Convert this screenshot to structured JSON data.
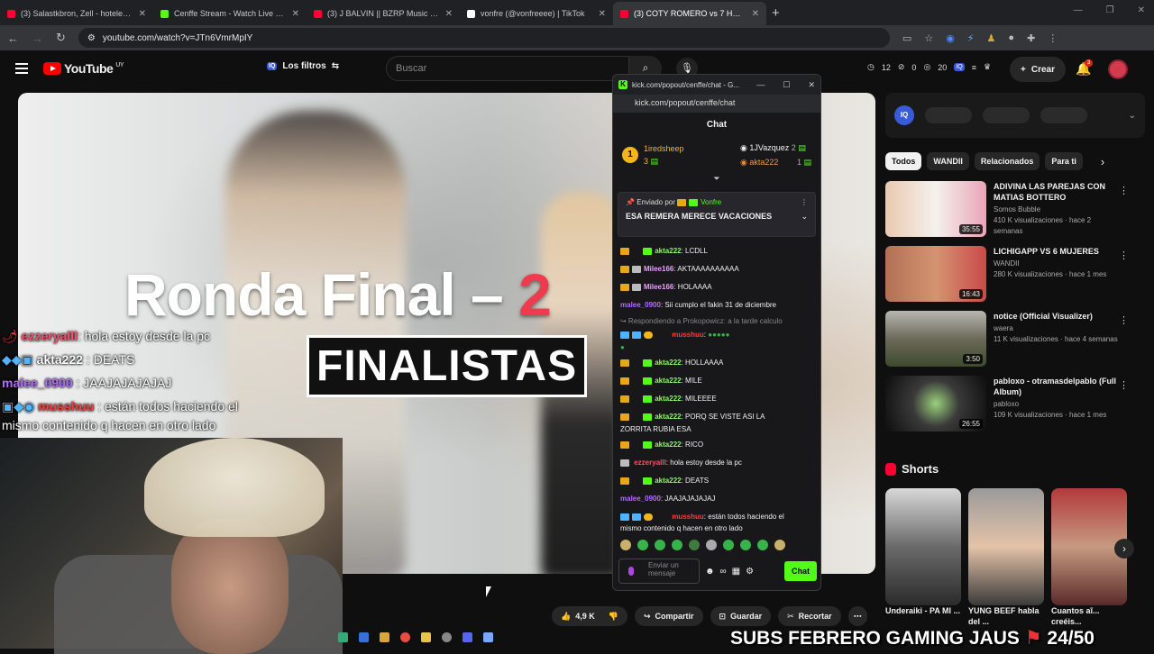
{
  "tabs": [
    {
      "title": "(3) Salastkbron, Zell - hoteles (p",
      "color": "#ff0033"
    },
    {
      "title": "Cenffe Stream - Watch Live on K",
      "color": "#53fc18"
    },
    {
      "title": "(3) J BALVIN || BZRP Music Sess",
      "color": "#ff0033"
    },
    {
      "title": "vonfre (@vonfreeee) | TikTok",
      "color": "#ffffff"
    },
    {
      "title": "(3) COTY ROMERO vs 7 HOMBR",
      "color": "#ff0033"
    }
  ],
  "browser": {
    "url": "youtube.com/watch?v=JTn6VmrMpIY",
    "new_tab": "+"
  },
  "youtube": {
    "logo": "YouTube",
    "country": "UY",
    "filters": "Los filtros",
    "iq": "IQ",
    "search_placeholder": "Buscar",
    "stats": {
      "a": "12",
      "b": "0",
      "c": "20"
    },
    "create": "Crear",
    "notif_count": "3"
  },
  "video": {
    "title_line": "Ronda Final –",
    "title_num": "2",
    "subtitle": "FINALISTAS"
  },
  "overlay_chat": [
    {
      "user": "ezzeryalll",
      "text": ": hola estoy desde la pc",
      "color": "#ff4d6d"
    },
    {
      "user": "akta222",
      "text": " : DEATS",
      "color": "#ffffff"
    },
    {
      "user": "malee_0900",
      "text": " : JAAJAJAJAJAJ",
      "color": "#b36bff"
    },
    {
      "user": "musshuu",
      "text": " : están todos haciendo el",
      "color": "#ff3b3b"
    },
    {
      "user": "",
      "text": "mismo contenido q hacen en otro lado",
      "color": "#ffffff"
    }
  ],
  "popout": {
    "title": "kick.com/popout/cenffe/chat - G...",
    "url": "kick.com/popout/cenffe/chat",
    "header": "Chat",
    "leaders": {
      "first": {
        "rank": "1",
        "name": "1iredsheep",
        "count": "3"
      },
      "second": {
        "name": "1JVazquez",
        "count": "2"
      },
      "third": {
        "name": "akta222",
        "count": "1"
      }
    },
    "pinned": {
      "by": "Enviado por",
      "user": "Vonfre",
      "message": "ESA REMERA MERECE VACACIONES"
    },
    "messages": [
      {
        "user": "akta222",
        "text": ": LCDLL",
        "color": "#53fc18"
      },
      {
        "user": "Milee166",
        "text": ": AKTAAAAAAAAAA",
        "color": "#e8a0ff"
      },
      {
        "user": "Milee166",
        "text": ": HOLAAAA",
        "color": "#e8a0ff"
      },
      {
        "user": "malee_0900",
        "text": ": Sii cumplo el fakin 31 de diciembre",
        "color": "#b36bff"
      },
      {
        "user": "",
        "text": "↪ Respondiendo a Prokopowicz: a la tarde calculo",
        "color": "#888888"
      },
      {
        "user": "musshuu",
        "text": ":",
        "color": "#ff3b3b"
      },
      {
        "user": "akta222",
        "text": ": HOLLAAAA",
        "color": "#53fc18"
      },
      {
        "user": "akta222",
        "text": ": MILE",
        "color": "#53fc18"
      },
      {
        "user": "akta222",
        "text": ": MILEEEE",
        "color": "#53fc18"
      },
      {
        "user": "akta222",
        "text": ": PORQ SE VISTE ASI LA",
        "color": "#53fc18"
      },
      {
        "user": "",
        "text": "ZORRITA RUBIA ESA",
        "color": "#ffffff"
      },
      {
        "user": "akta222",
        "text": ": RICO",
        "color": "#53fc18"
      },
      {
        "user": "ezzeryalll",
        "text": ": hola estoy desde la pc",
        "color": "#ff4d6d"
      },
      {
        "user": "akta222",
        "text": ": DEATS",
        "color": "#53fc18"
      },
      {
        "user": "malee_0900",
        "text": ": JAAJAJAJAJAJ",
        "color": "#b36bff"
      },
      {
        "user": "musshuu",
        "text": ": están todos haciendo el",
        "color": "#ff3b3b"
      },
      {
        "user": "",
        "text": "mismo contenido q hacen en otro lado",
        "color": "#ffffff"
      }
    ],
    "input_placeholder": "Enviar un mensaje",
    "send": "Chat"
  },
  "sidebar": {
    "iq": "IQ",
    "chips": [
      "Todos",
      "WANDII",
      "Relacionados",
      "Para ti"
    ],
    "recs": [
      {
        "title": "ADIVINA LAS PAREJAS CON MATIAS BOTTERO",
        "channel": "Somos Bubble",
        "meta": "410 K visualizaciones · hace 2 semanas",
        "duration": "35:55",
        "thumb": "linear-gradient(90deg,#e9c9b0,#f4f1ec,#e9a5b7)"
      },
      {
        "title": "LICHIGAPP VS 6 MUJERES",
        "channel": "WANDII",
        "meta": "280 K visualizaciones · hace 1 mes",
        "duration": "16:43",
        "thumb": "linear-gradient(90deg,#b27055,#d49470,#c94a4a)"
      },
      {
        "title": "notice (Official Visualizer)",
        "channel": "waera",
        "meta": "11 K visualizaciones · hace 4 semanas",
        "duration": "3:50",
        "thumb": "linear-gradient(180deg,#b7b7b0,#6c6a5a,#3d4a2e)"
      },
      {
        "title": "pabloxo - otramasdelpablo (Full Album)",
        "channel": "pabloxo",
        "meta": "109 K visualizaciones · hace 1 mes",
        "duration": "26:55",
        "thumb": "radial-gradient(circle at 50% 50%,#9ad07a,#3a3a3a 40%,#0d0d0d)"
      }
    ],
    "shorts_label": "Shorts",
    "shorts": [
      {
        "title": "Underaiki - PA MI ...",
        "thumb": "linear-gradient(180deg,#d8d8d8,#6a6a6a,#2b2b2b)"
      },
      {
        "title": "YUNG BEEF habla del ...",
        "thumb": "linear-gradient(180deg,#9a9a9a,#e4c3a8,#3a3a3a)"
      },
      {
        "title": "Cuantos aĩ... creéis...",
        "thumb": "linear-gradient(180deg,#b23a3a,#c69a80,#5a2a2a)"
      }
    ]
  },
  "actions": {
    "likes": "4,9 K",
    "share": "Compartir",
    "save": "Guardar",
    "clip": "Recortar"
  },
  "subs_banner": "SUBS FEBRERO GAMING JAUS",
  "subs_count": "24/50"
}
